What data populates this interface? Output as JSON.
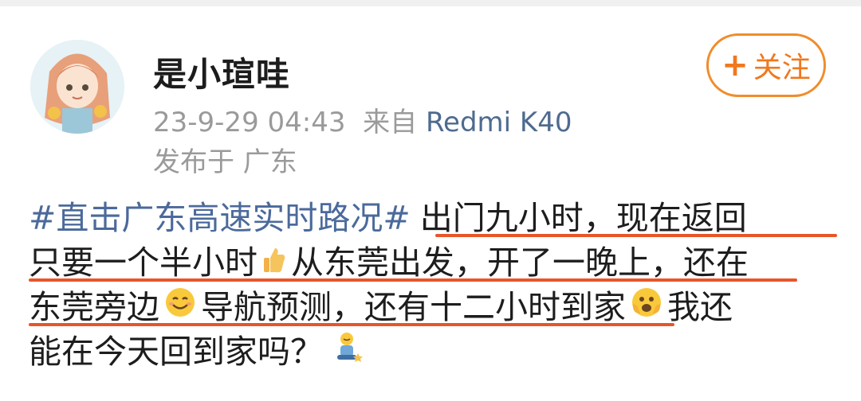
{
  "user": {
    "name": "是小瑄哇",
    "timestamp": "23-9-29 04:43",
    "source_prefix": "来自",
    "source_device": "Redmi K40",
    "location": "发布于 广东"
  },
  "follow_button": {
    "plus": "+",
    "label": "关注"
  },
  "post": {
    "line1_hashtag": "#直击广东高速实时路况#",
    "line1_text": "出门九小时，现在返回",
    "line2_a": "只要一个半小时",
    "line2_b": "从东莞出发，开了一晚上，还在",
    "line3_a": "东莞旁边",
    "line3_b": "导航预测，还有十二小时到家",
    "line3_c": "我还",
    "line4": "能在今天回到家吗？"
  },
  "colors": {
    "accent": "#f0781e",
    "hashtag": "#4b6a9b",
    "underline": "#e8552a",
    "meta": "#9a9a9a"
  },
  "icons": [
    "thumbs-up-icon",
    "smile-icon",
    "fearful-face-icon",
    "sitting-figure-icon"
  ]
}
